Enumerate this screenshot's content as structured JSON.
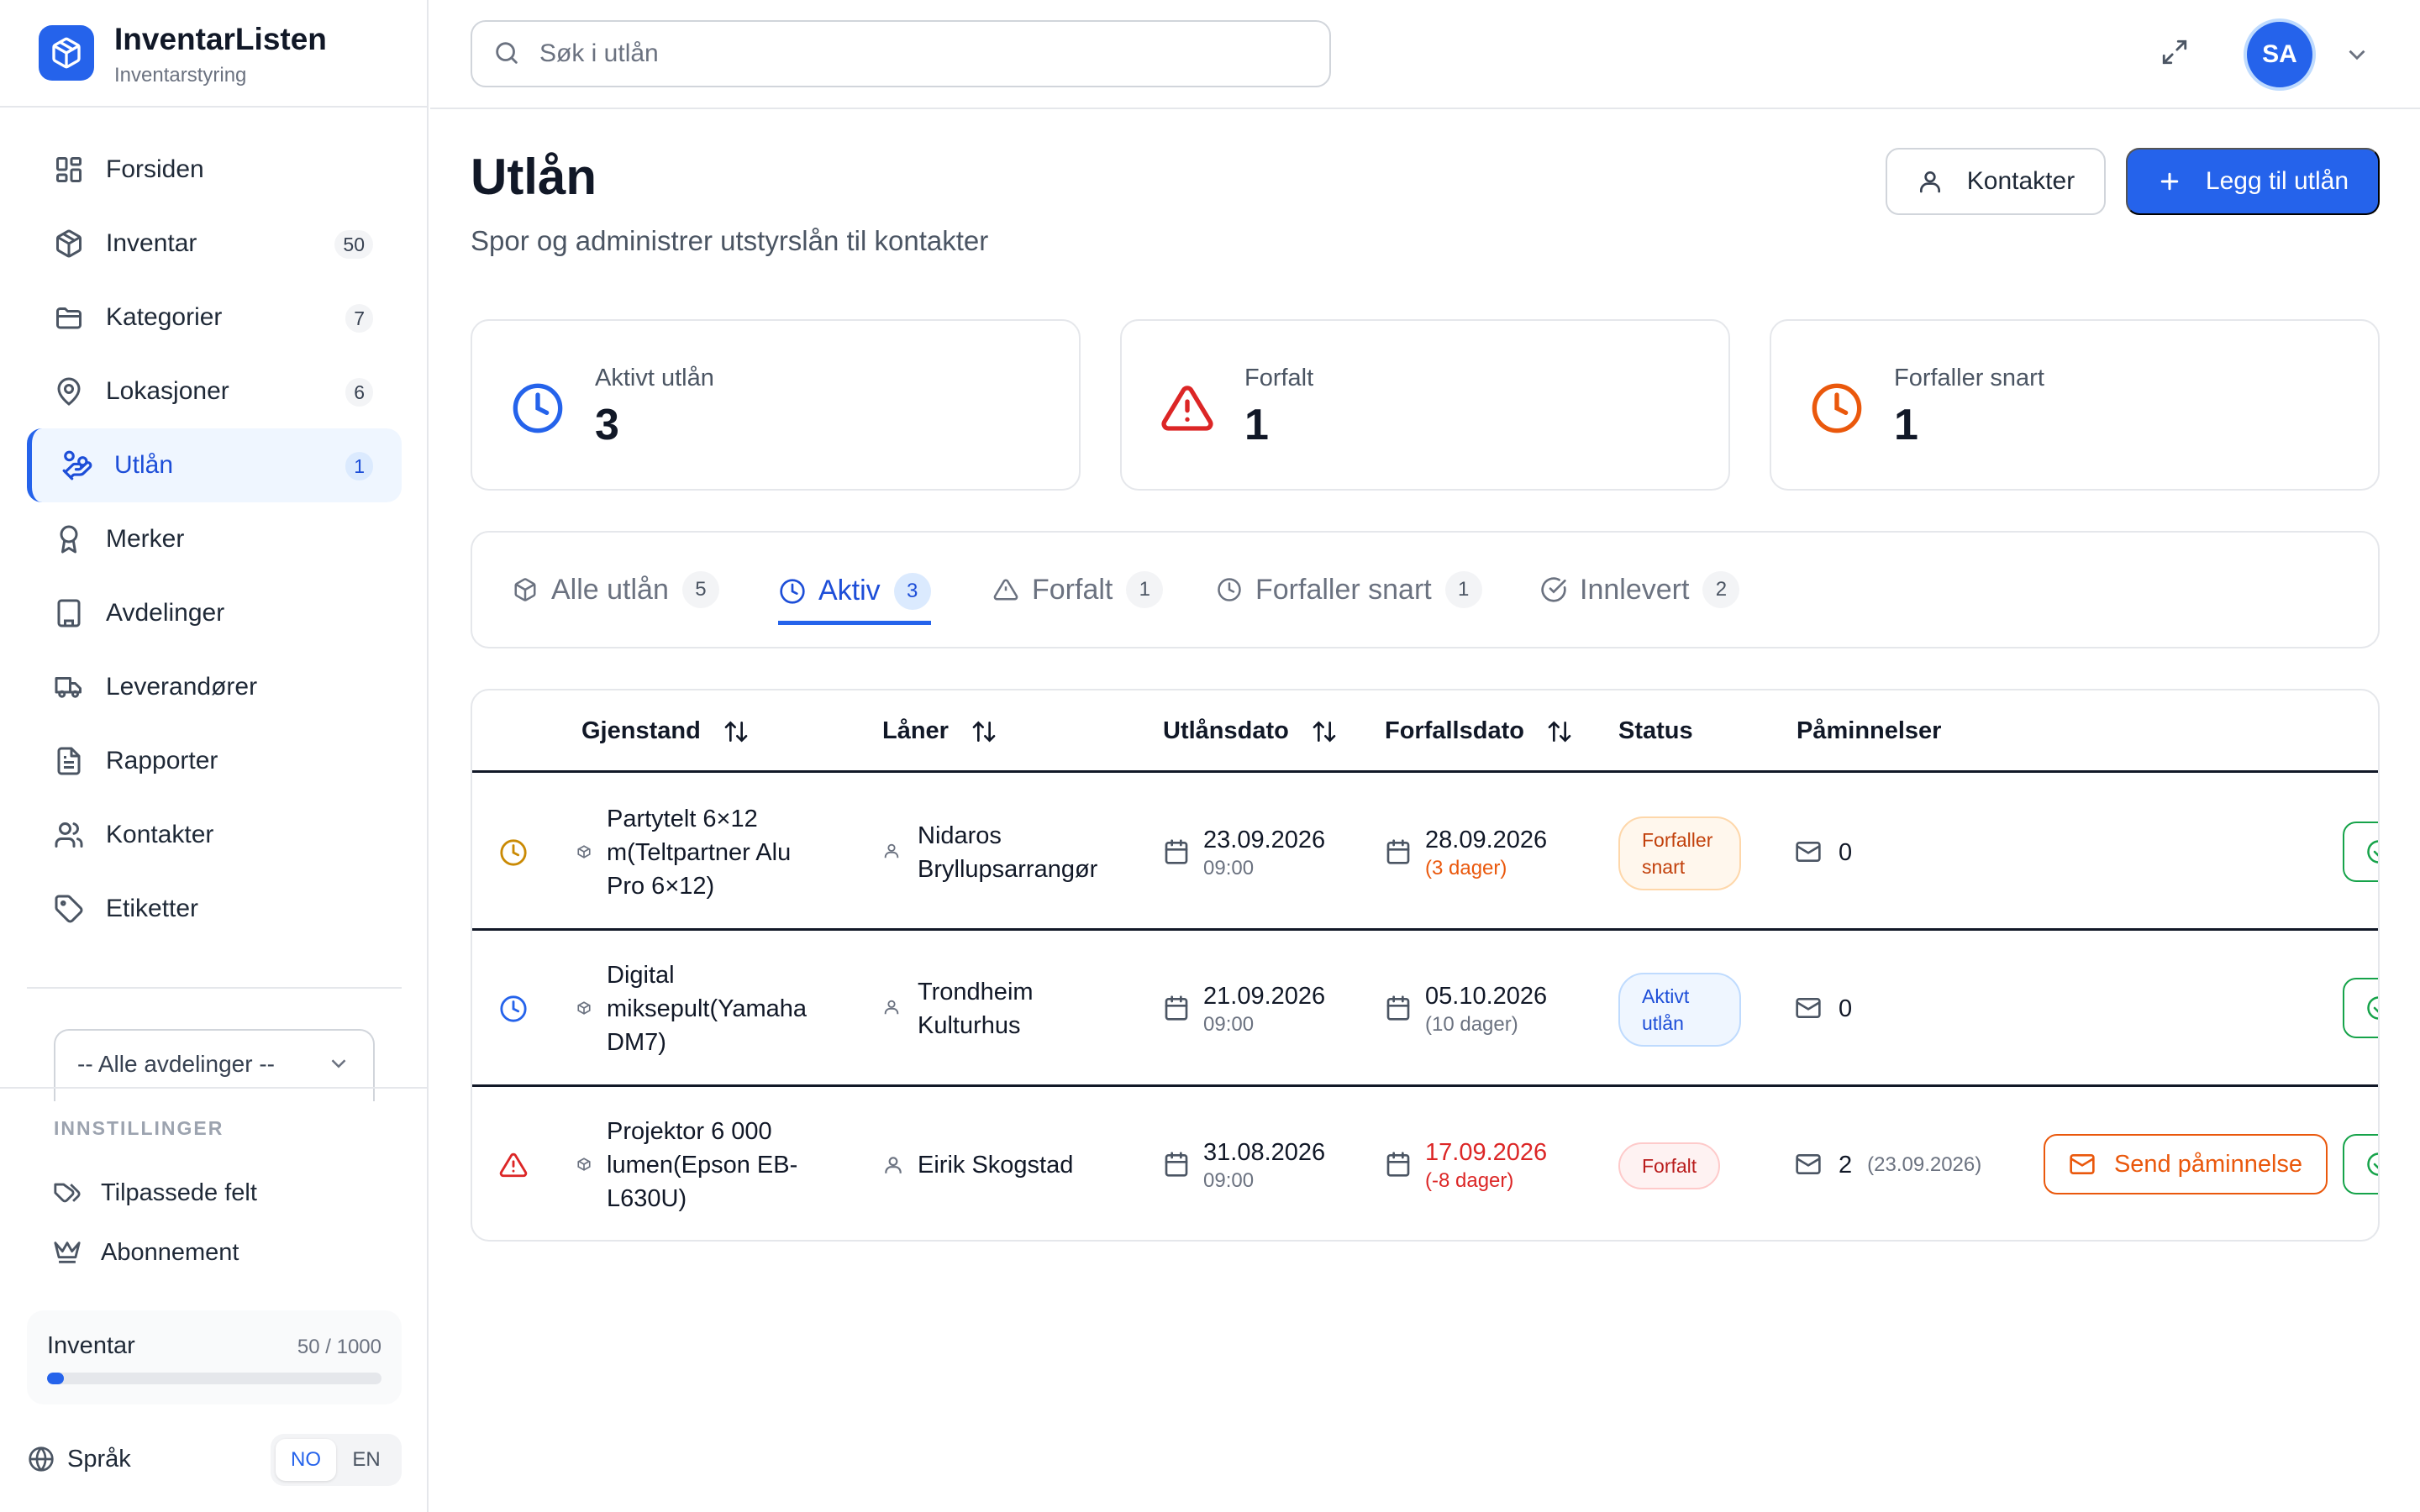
{
  "brand": {
    "name": "InventarListen",
    "subtitle": "Inventarstyring"
  },
  "nav": [
    {
      "label": "Forsiden",
      "count": null,
      "icon": "dashboard-icon"
    },
    {
      "label": "Inventar",
      "count": "50",
      "icon": "package-icon"
    },
    {
      "label": "Kategorier",
      "count": "7",
      "icon": "folder-icon"
    },
    {
      "label": "Lokasjoner",
      "count": "6",
      "icon": "map-pin-icon"
    },
    {
      "label": "Utlån",
      "count": "1",
      "icon": "hand-coins-icon",
      "active": true
    },
    {
      "label": "Merker",
      "count": null,
      "icon": "award-icon"
    },
    {
      "label": "Avdelinger",
      "count": null,
      "icon": "building-icon"
    },
    {
      "label": "Leverandører",
      "count": null,
      "icon": "truck-icon"
    },
    {
      "label": "Rapporter",
      "count": null,
      "icon": "file-text-icon"
    },
    {
      "label": "Kontakter",
      "count": null,
      "icon": "users-icon"
    },
    {
      "label": "Etiketter",
      "count": null,
      "icon": "tag-icon"
    }
  ],
  "department_select": {
    "value": "-- Alle avdelinger --"
  },
  "settings": {
    "heading": "INNSTILLINGER",
    "items": [
      {
        "label": "Tilpassede felt",
        "icon": "tags-icon"
      },
      {
        "label": "Abonnement",
        "icon": "crown-icon"
      }
    ]
  },
  "usage": {
    "label": "Inventar",
    "count_text": "50 / 1000",
    "fraction": 0.05
  },
  "language": {
    "label": "Språk",
    "options": [
      "NO",
      "EN"
    ],
    "selected": "NO"
  },
  "search": {
    "placeholder": "Søk i utlån",
    "value": ""
  },
  "user": {
    "initials": "SA"
  },
  "page": {
    "title": "Utlån",
    "subtitle": "Spor og administrer utstyrslån til kontakter"
  },
  "actions": {
    "contacts_label": "Kontakter",
    "add_label": "Legg til utlån"
  },
  "stats": [
    {
      "label": "Aktivt utlån",
      "value": "3",
      "icon": "clock-icon",
      "color": "#2563eb"
    },
    {
      "label": "Forfalt",
      "value": "1",
      "icon": "alert-triangle-icon",
      "color": "#dc2626"
    },
    {
      "label": "Forfaller snart",
      "value": "1",
      "icon": "clock-icon",
      "color": "#ea580c"
    }
  ],
  "tabs": [
    {
      "label": "Alle utlån",
      "count": "5",
      "icon": "package-icon"
    },
    {
      "label": "Aktiv",
      "count": "3",
      "icon": "clock-icon",
      "active": true
    },
    {
      "label": "Forfalt",
      "count": "1",
      "icon": "alert-triangle-icon"
    },
    {
      "label": "Forfaller snart",
      "count": "1",
      "icon": "clock-icon"
    },
    {
      "label": "Innlevert",
      "count": "2",
      "icon": "check-circle-icon"
    }
  ],
  "table": {
    "headers": {
      "item": "Gjenstand",
      "borrower": "Låner",
      "loan_date": "Utlånsdato",
      "due_date": "Forfallsdato",
      "status": "Status",
      "reminders": "Påminnelser"
    },
    "rows": [
      {
        "status_icon": "clock-icon",
        "status_color": "#ca8a04",
        "item": "Partytelt 6×12 m(Teltpartner Alu Pro 6×12)",
        "borrower": "Nidaros Bryllupsarrangør",
        "loan_date": "23.09.2026",
        "loan_time": "09:00",
        "due_date": "28.09.2026",
        "due_note": "(3 dager)",
        "status": "Forfaller snart",
        "status_kind": "soon",
        "reminders": "0",
        "reminder_date": ""
      },
      {
        "status_icon": "clock-icon",
        "status_color": "#2563eb",
        "item": "Digital miksepult(Yamaha DM7)",
        "borrower": "Trondheim Kulturhus",
        "loan_date": "21.09.2026",
        "loan_time": "09:00",
        "due_date": "05.10.2026",
        "due_note": "(10 dager)",
        "status": "Aktivt utlån",
        "status_kind": "active",
        "reminders": "0",
        "reminder_date": ""
      },
      {
        "status_icon": "alert-triangle-icon",
        "status_color": "#dc2626",
        "item": "Projektor 6 000 lumen(Epson EB-L630U)",
        "borrower": "Eirik Skogstad",
        "loan_date": "31.08.2026",
        "loan_time": "09:00",
        "due_date": "17.09.2026",
        "due_note": "(-8 dager)",
        "status": "Forfalt",
        "status_kind": "over",
        "reminders": "2",
        "reminder_date": "(23.09.2026)",
        "send_label": "Send påminnelse"
      }
    ]
  }
}
